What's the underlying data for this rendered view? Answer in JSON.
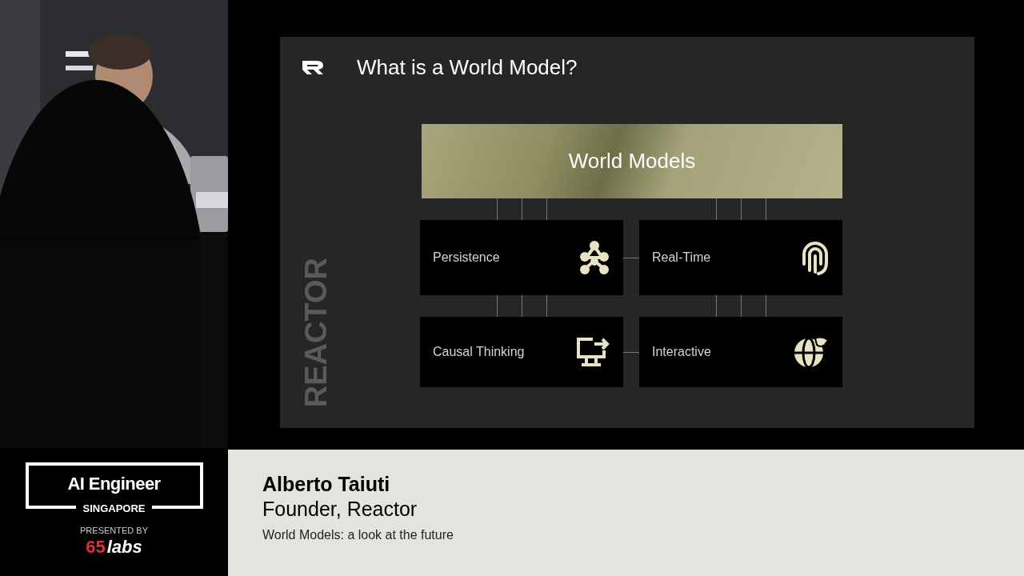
{
  "slide": {
    "title": "What is a World Model?",
    "side_label": "REACTOR",
    "hub": "World Models",
    "cards": [
      {
        "label": "Persistence"
      },
      {
        "label": "Real-Time"
      },
      {
        "label": "Causal Thinking"
      },
      {
        "label": "Interactive"
      }
    ]
  },
  "lower_third": {
    "event": {
      "name": "AI Engineer",
      "location": "SINGAPORE",
      "presented_by": "PRESENTED BY",
      "sponsor_number": "65",
      "sponsor_word": "labs"
    },
    "speaker": {
      "name": "Alberto Taiuti",
      "role": "Founder, Reactor",
      "talk": "World Models: a look at the future"
    }
  }
}
